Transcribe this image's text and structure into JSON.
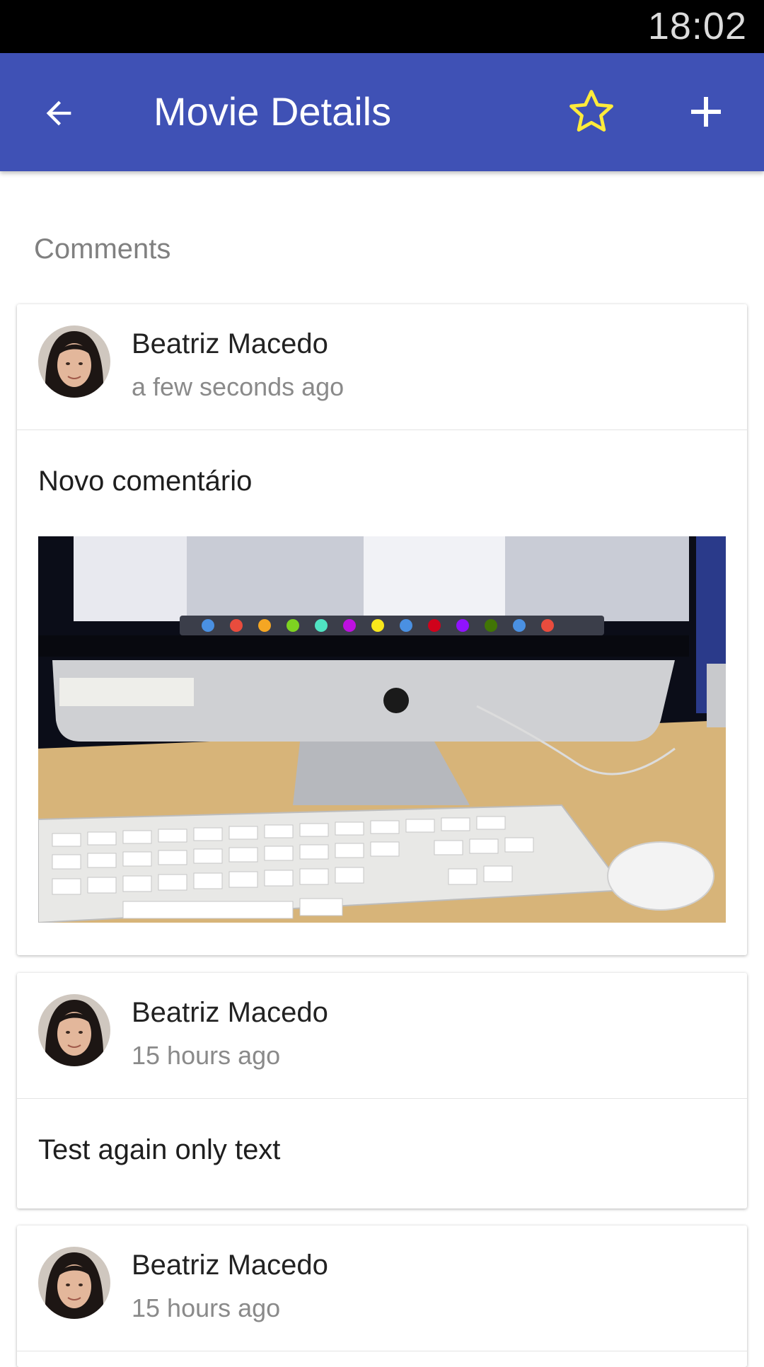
{
  "status_bar": {
    "time": "18:02"
  },
  "app_bar": {
    "title": "Movie Details",
    "colors": {
      "background": "#3f51b5",
      "star": "#ffeb3b"
    }
  },
  "comments_section": {
    "heading": "Comments",
    "items": [
      {
        "author": "Beatriz Macedo",
        "time": "a few seconds ago",
        "text": "Novo comentário",
        "has_image": true
      },
      {
        "author": "Beatriz Macedo",
        "time": "15 hours ago",
        "text": "Test again only text",
        "has_image": false
      },
      {
        "author": "Beatriz Macedo",
        "time": "15 hours ago"
      }
    ]
  },
  "icons": {
    "back": "arrow-back-icon",
    "favorite": "star-outline-icon",
    "add": "plus-icon"
  }
}
